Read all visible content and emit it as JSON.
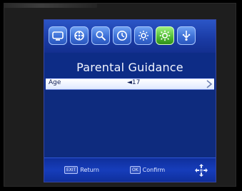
{
  "window": {
    "title": "Parental Guidance"
  },
  "topbar": {
    "icons": [
      {
        "name": "tv-icon",
        "active": false
      },
      {
        "name": "film-reel-icon",
        "active": false
      },
      {
        "name": "search-icon",
        "active": false
      },
      {
        "name": "clock-icon",
        "active": false
      },
      {
        "name": "settings-icon",
        "active": false
      },
      {
        "name": "gear-icon",
        "active": true
      },
      {
        "name": "usb-icon",
        "active": false
      }
    ]
  },
  "main": {
    "settings_rows": [
      {
        "label": "Age",
        "value": "◄17"
      }
    ]
  },
  "footer": {
    "hints": [
      {
        "key_label": "EXIT",
        "text": "Return"
      },
      {
        "key_label": "OK",
        "text": "Confirm"
      }
    ],
    "navigation_icon": "dpad-icon"
  },
  "colors": {
    "screen_bg": "#0d2c86",
    "selected_row_bg": "#ffffff",
    "active_tab": "#4fbc33",
    "title_text": "#f3f6ff"
  }
}
